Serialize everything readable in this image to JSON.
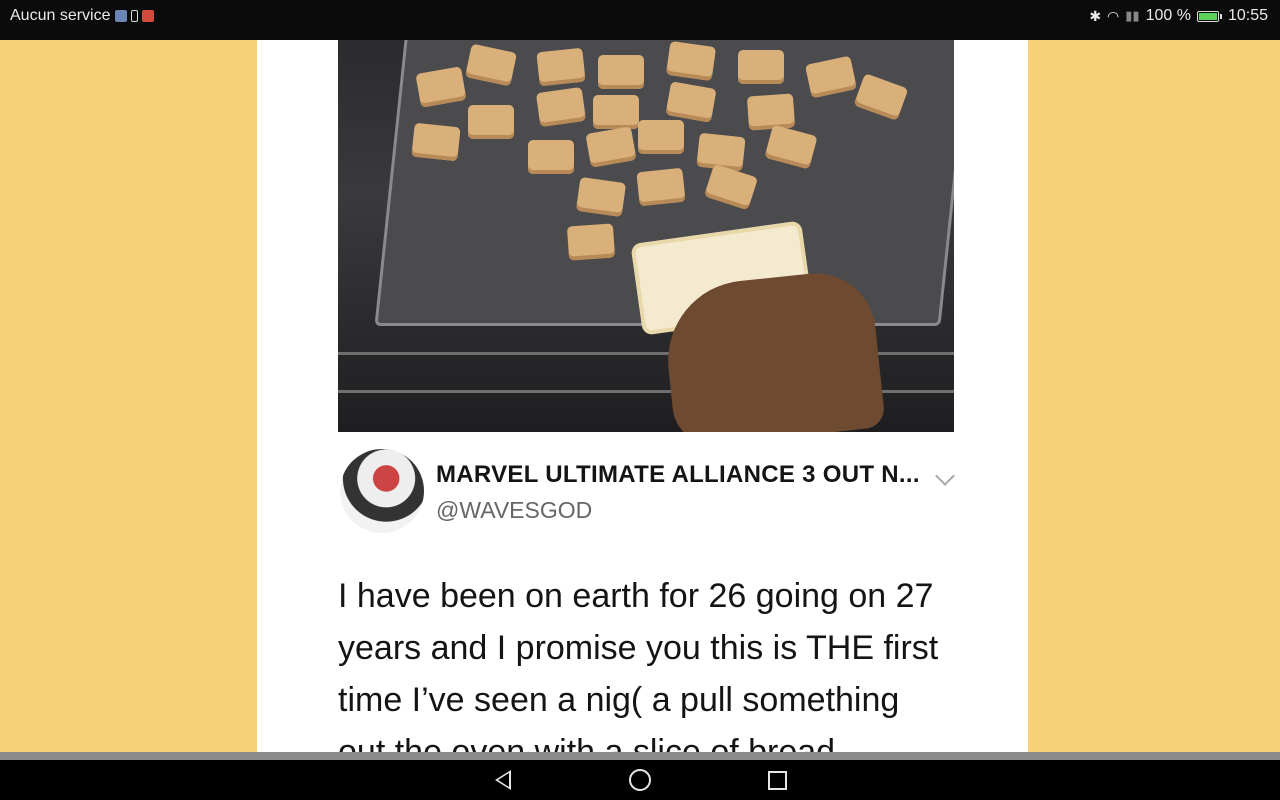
{
  "status_bar": {
    "carrier": "Aucun service",
    "battery_percent": "100 %",
    "time": "10:55",
    "icons": [
      "sim-icon",
      "battery-saver-icon",
      "notification-icon",
      "bluetooth-icon",
      "wifi-icon",
      "signal-icon",
      "battery-icon"
    ]
  },
  "tweet": {
    "display_name": "MARVEL ULTIMATE ALLIANCE 3 OUT N...",
    "handle": "@WAVESGOD",
    "text_lines": [
      "I have been on earth for 26 going on 27",
      "years and I promise you this is THE first",
      "time I’ve seen a nig( a pull something",
      "out the oven with a slice of bread"
    ]
  },
  "nav_bar": {
    "buttons": [
      "back",
      "home",
      "recents"
    ]
  },
  "colors": {
    "background": "#f8d27b",
    "battery_fill": "#5bd35b"
  }
}
